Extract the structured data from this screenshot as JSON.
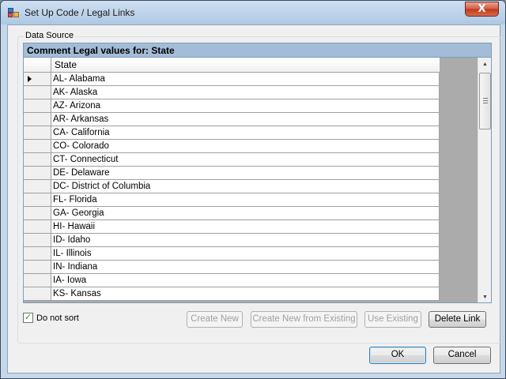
{
  "window": {
    "title": "Set Up Code / Legal Links",
    "close_label": "X"
  },
  "data_source": {
    "legend": "Data Source",
    "grid_caption": "Comment Legal values for: State",
    "column_header": "State",
    "rows": [
      "AL- Alabama",
      "AK- Alaska",
      "AZ- Arizona",
      "AR- Arkansas",
      "CA- California",
      "CO- Colorado",
      "CT- Connecticut",
      "DE- Delaware",
      "DC- District of Columbia",
      "FL- Florida",
      "GA- Georgia",
      "HI- Hawaii",
      "ID- Idaho",
      "IL- Illinois",
      "IN- Indiana",
      "IA- Iowa",
      "KS- Kansas"
    ],
    "selected_row": 0
  },
  "options": {
    "do_not_sort_label": "Do not sort",
    "do_not_sort_checked": true
  },
  "buttons": {
    "create_new": "Create New",
    "create_new_from_existing": "Create New from Existing",
    "use_existing": "Use Existing",
    "delete_link": "Delete Link",
    "ok": "OK",
    "cancel": "Cancel"
  },
  "icons": {
    "title": "app-window-icon",
    "close": "close-icon",
    "row_pointer": "current-row-arrow-icon",
    "scroll_up": "scroll-up-arrow-icon",
    "scroll_down": "scroll-down-arrow-icon"
  }
}
